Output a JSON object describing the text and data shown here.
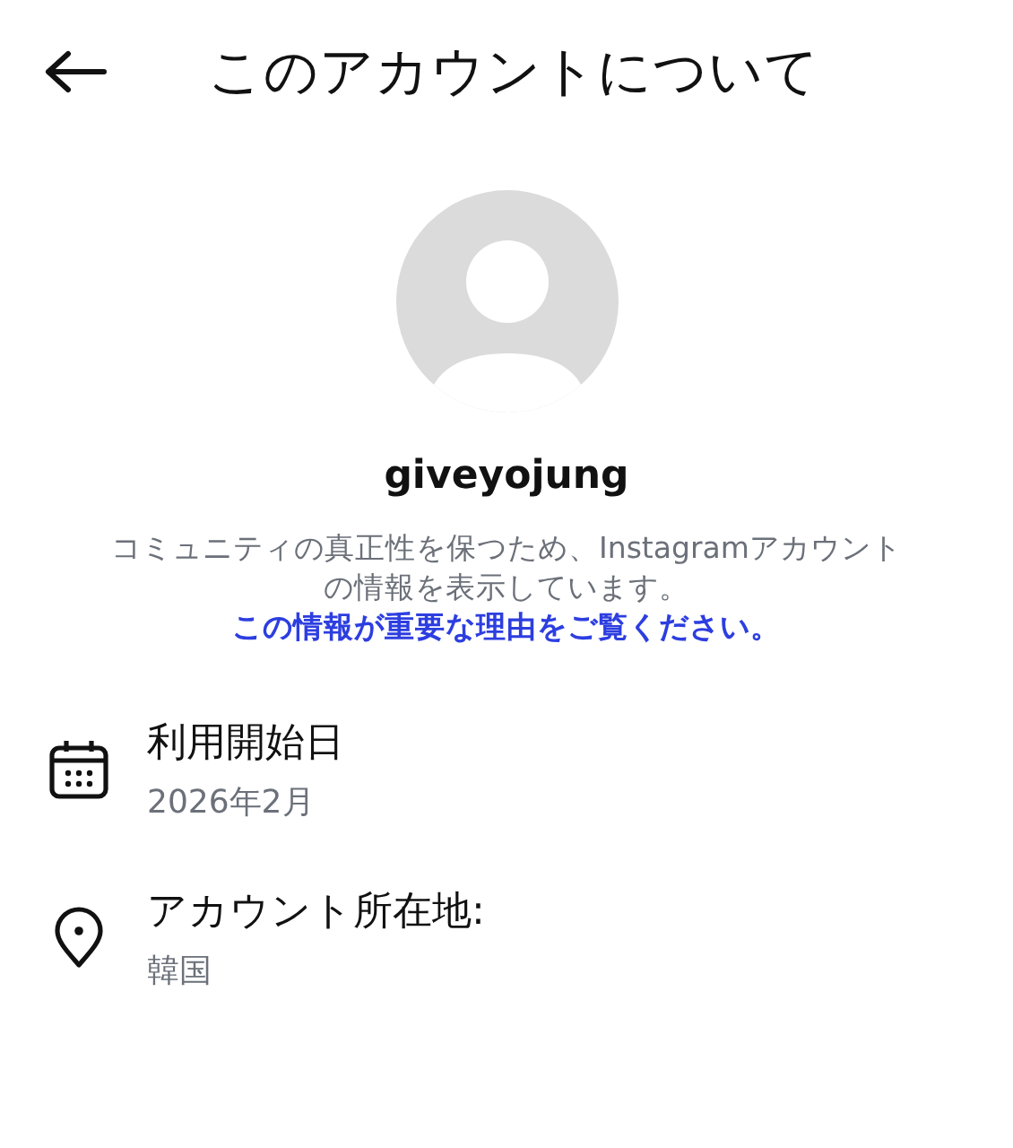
{
  "header": {
    "title": "このアカウントについて"
  },
  "profile": {
    "username": "giveyojung",
    "description": "コミュニティの真正性を保つため、Instagramアカウントの情報を表示しています。",
    "link": "この情報が重要な理由をご覧ください。"
  },
  "details": [
    {
      "kind": "calendar",
      "label": "利用開始日",
      "value": "2026年2月"
    },
    {
      "kind": "location",
      "label": "アカウント所在地:",
      "value": "韓国"
    }
  ]
}
